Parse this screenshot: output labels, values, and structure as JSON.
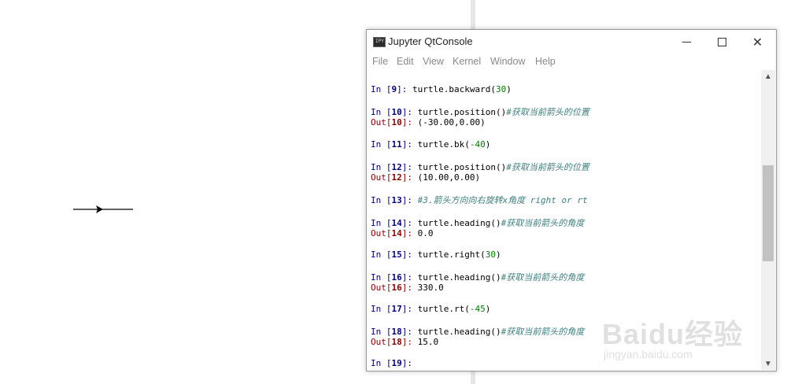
{
  "window": {
    "title": "Jupyter QtConsole",
    "icon_name": "jupyter-console-icon",
    "icon_text": "IPY"
  },
  "menu": [
    "File",
    "Edit",
    "View",
    "Kernel",
    "Window",
    "Help"
  ],
  "console": {
    "lines": [
      {
        "type": "partial",
        "text": ""
      },
      {
        "type": "in",
        "n": "9",
        "code": "turtle.backward(30)"
      },
      {
        "type": "in",
        "n": "10",
        "code": "turtle.position()",
        "comment": "#获取当前箭头的位置"
      },
      {
        "type": "out",
        "n": "10",
        "value": "(-30.00,0.00)"
      },
      {
        "type": "in",
        "n": "11",
        "code": "turtle.bk(-40)"
      },
      {
        "type": "in",
        "n": "12",
        "code": "turtle.position()",
        "comment": "#获取当前箭头的位置"
      },
      {
        "type": "out",
        "n": "12",
        "value": "(10.00,0.00)"
      },
      {
        "type": "in",
        "n": "13",
        "code": "",
        "comment": "#3.箭头方向向右旋转x角度 right or rt"
      },
      {
        "type": "in",
        "n": "14",
        "code": "turtle.heading()",
        "comment": "#获取当前箭头的角度"
      },
      {
        "type": "out",
        "n": "14",
        "value": "0.0"
      },
      {
        "type": "in",
        "n": "15",
        "code": "turtle.right(30)"
      },
      {
        "type": "in",
        "n": "16",
        "code": "turtle.heading()",
        "comment": "#获取当前箭头的角度"
      },
      {
        "type": "out",
        "n": "16",
        "value": "330.0"
      },
      {
        "type": "in",
        "n": "17",
        "code": "turtle.rt(-45)"
      },
      {
        "type": "in",
        "n": "18",
        "code": "turtle.heading()",
        "comment": "#获取当前箭头的角度"
      },
      {
        "type": "out",
        "n": "18",
        "value": "15.0"
      },
      {
        "type": "in",
        "n": "19",
        "code": ""
      }
    ]
  },
  "watermark": {
    "logo": "Baidu经验",
    "url": "jingyan.baidu.com"
  },
  "colors": {
    "in_prompt": "#000080",
    "out_prompt": "#8b0000",
    "number": "#008000",
    "comment": "#408080"
  }
}
